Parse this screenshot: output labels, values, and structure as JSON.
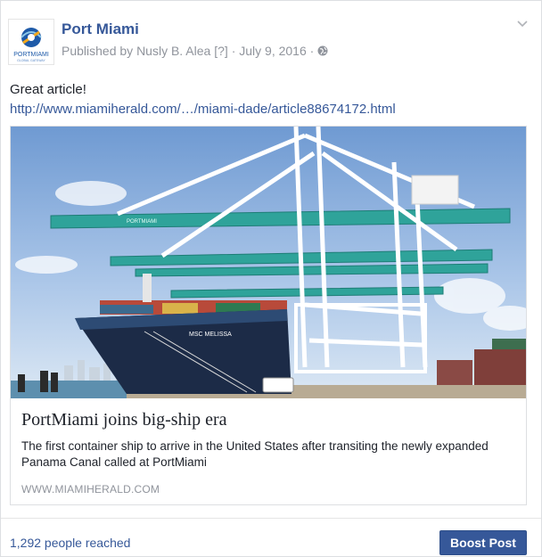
{
  "post": {
    "page_name": "Port Miami",
    "published_prefix": "Published by",
    "author": "Nusly B. Alea",
    "author_help": "[?]",
    "date": "July 9, 2016",
    "separator": "·",
    "privacy_icon": "globe-icon",
    "menu_icon": "chevron-down-icon",
    "message": "Great article!",
    "link_text": "http://www.miamiherald.com/…/miami-dade/article88674172.html"
  },
  "logo": {
    "text": "PORTMIAMI",
    "subtext": "GLOBAL GATEWAY"
  },
  "share": {
    "title": "PortMiami joins big-ship era",
    "description": "The first container ship to arrive in the United States after transiting the newly expanded Panama Canal called at PortMiami",
    "domain": "WWW.MIAMIHERALD.COM",
    "ship_name": "MSC MELISSA",
    "crane_label": "PORTMIAMI"
  },
  "footer": {
    "reach_text": "1,292 people reached",
    "boost_label": "Boost Post"
  },
  "colors": {
    "link": "#365899",
    "boost": "#365899",
    "crane": "#2fa39a",
    "sky": "#8fb4dc"
  }
}
